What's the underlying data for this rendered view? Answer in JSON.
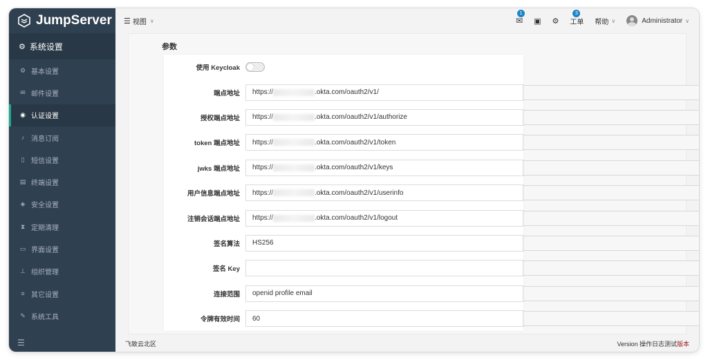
{
  "app": {
    "name": "JumpServer"
  },
  "sidebar": {
    "header": "系统设置",
    "items": [
      {
        "label": "基本设置",
        "icon": "gear-icon"
      },
      {
        "label": "邮件设置",
        "icon": "mail-icon"
      },
      {
        "label": "认证设置",
        "icon": "user-circle-icon",
        "active": true
      },
      {
        "label": "消息订阅",
        "icon": "bell-icon"
      },
      {
        "label": "短信设置",
        "icon": "phone-icon"
      },
      {
        "label": "终端设置",
        "icon": "terminal-icon"
      },
      {
        "label": "安全设置",
        "icon": "shield-icon"
      },
      {
        "label": "定期清理",
        "icon": "hourglass-icon"
      },
      {
        "label": "界面设置",
        "icon": "monitor-icon"
      },
      {
        "label": "组织管理",
        "icon": "org-icon"
      },
      {
        "label": "其它设置",
        "icon": "list-icon"
      },
      {
        "label": "系统工具",
        "icon": "wrench-icon"
      }
    ]
  },
  "topbar": {
    "view_label": "视图",
    "mail_badge": "1",
    "ticket_label": "工单",
    "ticket_badge": "3",
    "help_label": "帮助",
    "user_name": "Administrator"
  },
  "content": {
    "section_title": "参数"
  },
  "form": {
    "rows": [
      {
        "label": "使用 Keycloak",
        "type": "toggle",
        "value": ""
      },
      {
        "label": "端点地址",
        "prefix": "https://",
        "suffix": ".okta.com/oauth2/v1/"
      },
      {
        "label": "授权端点地址",
        "prefix": "https://",
        "suffix": ".okta.com/oauth2/v1/authorize"
      },
      {
        "label": "token 端点地址",
        "prefix": "https://",
        "suffix": ".okta.com/oauth2/v1/token"
      },
      {
        "label": "jwks 端点地址",
        "prefix": "https://",
        "suffix": ".okta.com/oauth2/v1/keys"
      },
      {
        "label": "用户信息端点地址",
        "prefix": "https://",
        "suffix": ".okta.com/oauth2/v1/userinfo"
      },
      {
        "label": "注销会话端点地址",
        "prefix": "https://",
        "suffix": ".okta.com/oauth2/v1/logout"
      },
      {
        "label": "签名算法",
        "value": "HS256"
      },
      {
        "label": "签名 Key",
        "value": ""
      },
      {
        "label": "连接范围",
        "value": "openid profile email"
      },
      {
        "label": "令牌有效时间",
        "value": "60"
      }
    ]
  },
  "footer": {
    "left": "飞致云北区",
    "right_prefix": "Version 操作日志测试",
    "right_highlight": "版本"
  },
  "colors": {
    "sidebar": "#2f4050",
    "accent": "#19aa8d",
    "badge": "#1c84c6"
  }
}
